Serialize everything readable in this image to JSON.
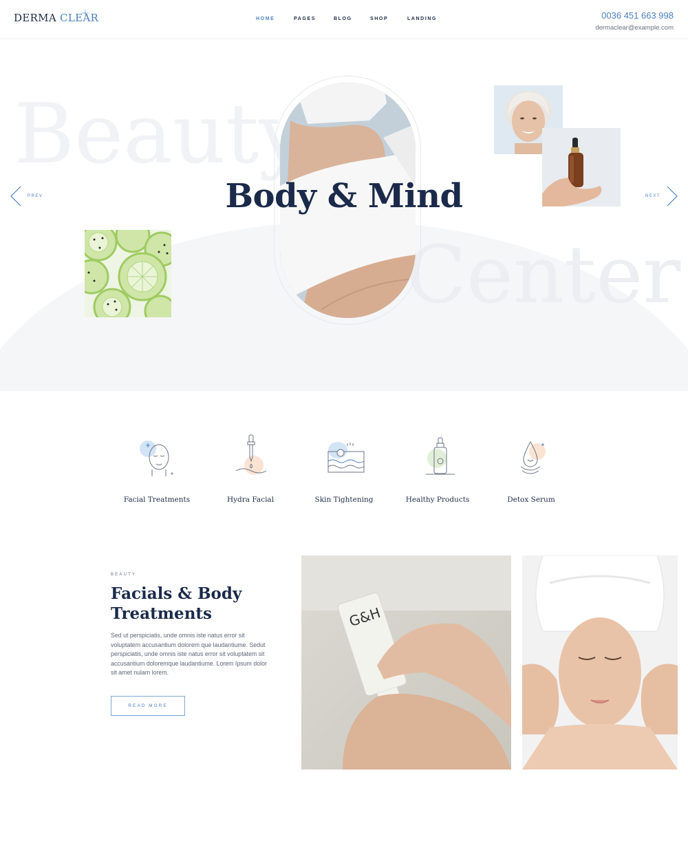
{
  "header": {
    "logo": {
      "part1": "DERMA",
      "part2": "CLEAR"
    },
    "nav": [
      "HOME",
      "PAGES",
      "BLOG",
      "SHOP",
      "LANDING"
    ],
    "phone": "0036 451 663 998",
    "email": "dermaclear@example.com"
  },
  "hero": {
    "title": "Body & Mind",
    "bg_word_1": "Beauty",
    "bg_word_2": "Center",
    "prev": "PREV",
    "next": "NEXT"
  },
  "services": [
    {
      "label": "Facial Treatments",
      "icon": "face-icon"
    },
    {
      "label": "Hydra Facial",
      "icon": "dropper-icon"
    },
    {
      "label": "Skin Tightening",
      "icon": "skin-layers-icon"
    },
    {
      "label": "Healthy Products",
      "icon": "serum-bottle-icon"
    },
    {
      "label": "Detox Serum",
      "icon": "droplet-icon"
    }
  ],
  "treatments": {
    "eyebrow": "BEAUTY",
    "title_line1": "Facials & Body",
    "title_line2": "Treatments",
    "body": "Sed ut perspiciatis, unde omnis iste natus error sit voluptatem accusantium dolorem que laudantiume. Sedut perspiciatis, unde omnis iste natus error sit voluptatem sit accusantium doloremque laudantiume. Lorem Ipsum dolor sit amet nulam lorem.",
    "button": "READ MORE",
    "product_text": "G&H"
  },
  "colors": {
    "accent": "#4a7fbd",
    "navy": "#1b2a4a",
    "arc": "#f5f6f8"
  }
}
